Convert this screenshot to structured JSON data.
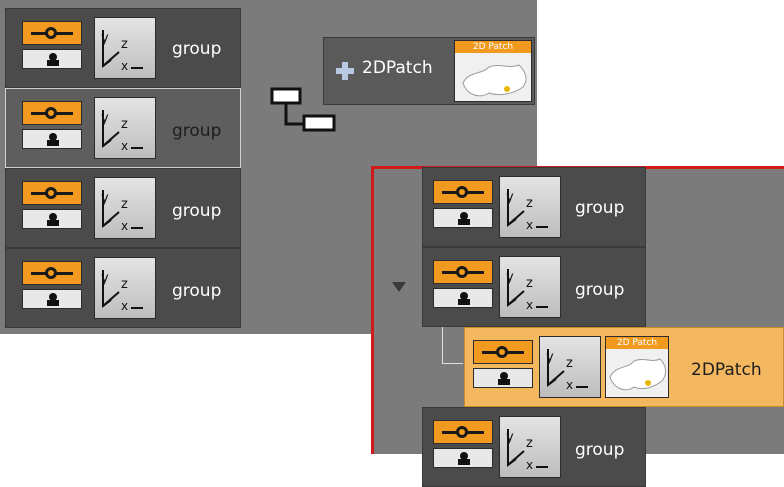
{
  "left_panel": {
    "rows": [
      {
        "label": "group",
        "selected": false
      },
      {
        "label": "group",
        "selected": true
      },
      {
        "label": "group",
        "selected": false
      },
      {
        "label": "group",
        "selected": false
      }
    ],
    "patch_node": {
      "label": "2DPatch",
      "thumb_tag": "2D Patch",
      "icon": "plus-icon"
    }
  },
  "zoom_panel": {
    "rows": [
      {
        "label": "group"
      },
      {
        "label": "group",
        "expanded": true
      },
      {
        "label": "2DPatch",
        "thumb_tag": "2D Patch",
        "highlighted": true
      },
      {
        "label": "group"
      }
    ]
  },
  "colors": {
    "accent": "#f29a1f",
    "panel_bg": "#7b7b7b",
    "row_bg": "#4b4b4b",
    "highlight_bg": "#f3b760",
    "zoom_border": "#d11a1a"
  }
}
